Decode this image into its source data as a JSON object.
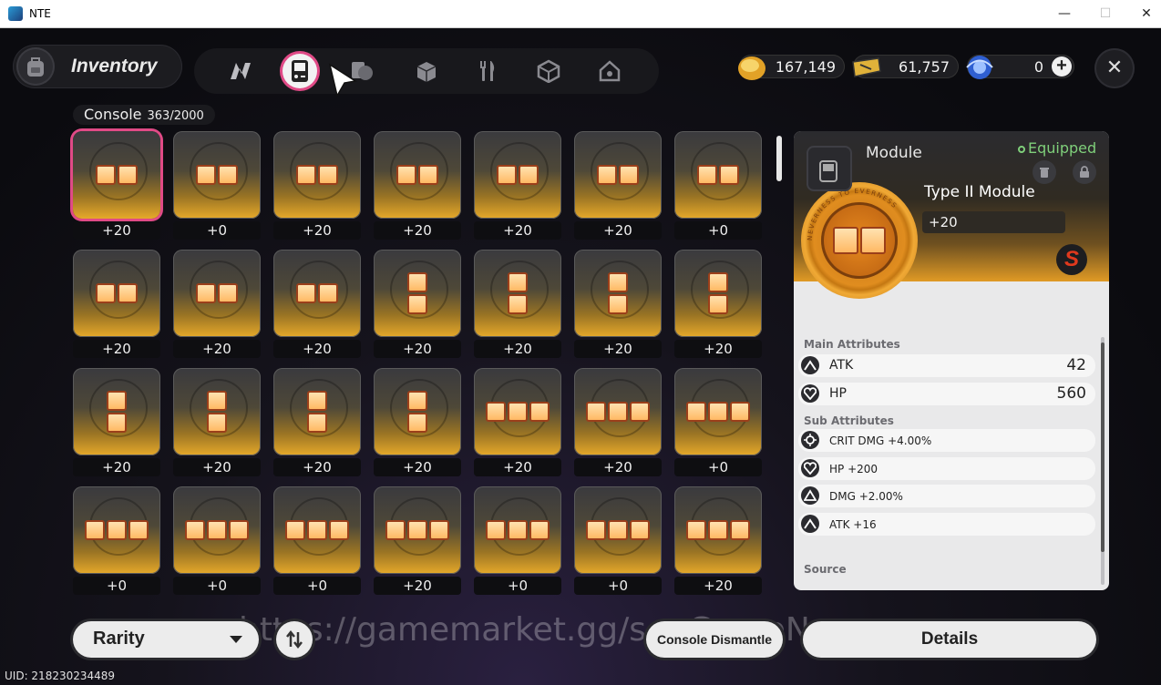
{
  "window": {
    "title": "NTE",
    "minimize": "—",
    "maximize": "☐",
    "close": "✕"
  },
  "header": {
    "title": "Inventory",
    "tabs": [
      "n-logo",
      "console",
      "card",
      "box",
      "fork-knife",
      "cube",
      "home"
    ],
    "active_tab": "console",
    "currencies": [
      {
        "icon": "gold-coin-icon",
        "value": "167,149"
      },
      {
        "icon": "ticket-icon",
        "value": "61,757"
      },
      {
        "icon": "blue-orb-icon",
        "value": "0"
      }
    ],
    "close_label": "✕"
  },
  "console_label": {
    "name": "Console",
    "count": "363/2000"
  },
  "items": [
    {
      "level": "+20",
      "shape": "h2",
      "selected": true
    },
    {
      "level": "+0",
      "shape": "h2"
    },
    {
      "level": "+20",
      "shape": "h2"
    },
    {
      "level": "+20",
      "shape": "h2"
    },
    {
      "level": "+20",
      "shape": "h2"
    },
    {
      "level": "+20",
      "shape": "h2"
    },
    {
      "level": "+0",
      "shape": "h2"
    },
    {
      "level": "+20",
      "shape": "h2"
    },
    {
      "level": "+20",
      "shape": "h2"
    },
    {
      "level": "+20",
      "shape": "h2"
    },
    {
      "level": "+20",
      "shape": "v2"
    },
    {
      "level": "+20",
      "shape": "v2"
    },
    {
      "level": "+20",
      "shape": "v2"
    },
    {
      "level": "+20",
      "shape": "v2"
    },
    {
      "level": "+20",
      "shape": "v2"
    },
    {
      "level": "+20",
      "shape": "v2"
    },
    {
      "level": "+20",
      "shape": "v2"
    },
    {
      "level": "+20",
      "shape": "v2"
    },
    {
      "level": "+20",
      "shape": "h3"
    },
    {
      "level": "+20",
      "shape": "h3"
    },
    {
      "level": "+0",
      "shape": "h3"
    },
    {
      "level": "+0",
      "shape": "h3"
    },
    {
      "level": "+0",
      "shape": "h3"
    },
    {
      "level": "+0",
      "shape": "h3"
    },
    {
      "level": "+20",
      "shape": "h3"
    },
    {
      "level": "+0",
      "shape": "h3"
    },
    {
      "level": "+0",
      "shape": "h3"
    },
    {
      "level": "+20",
      "shape": "h3"
    }
  ],
  "detail": {
    "category": "Module",
    "status": "Equipped",
    "name": "Type II Module",
    "level": "+20",
    "medal_text": "NEVERNESS TO EVERNESS",
    "main_attr_title": "Main Attributes",
    "main_attrs": [
      {
        "name": "ATK",
        "value": "42",
        "icon": "atk-icon"
      },
      {
        "name": "HP",
        "value": "560",
        "icon": "hp-icon"
      }
    ],
    "sub_attr_title": "Sub Attributes",
    "sub_attrs": [
      {
        "name": "CRIT DMG +4.00%",
        "icon": "crit-icon"
      },
      {
        "name": "HP +200",
        "icon": "hp-icon"
      },
      {
        "name": "DMG +2.00%",
        "icon": "dmg-icon"
      },
      {
        "name": "ATK +16",
        "icon": "atk-icon"
      }
    ],
    "source_title": "Source"
  },
  "footer": {
    "rarity_label": "Rarity",
    "dismantle_label": "Console Dismantle",
    "details_label": "Details",
    "uid": "UID: 218230234489",
    "watermark": "https://gamemarket.gg/s... GameNews"
  },
  "colors": {
    "accent_pink": "#e04a86",
    "gold": "#e6a92a",
    "equipped_green": "#7fcf7a"
  }
}
